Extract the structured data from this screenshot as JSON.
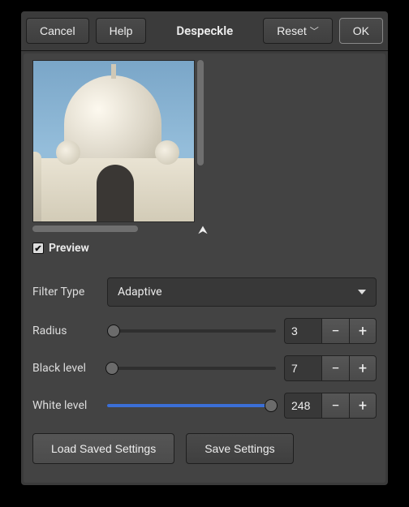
{
  "header": {
    "cancel": "Cancel",
    "help": "Help",
    "title": "Despeckle",
    "reset": "Reset",
    "ok": "OK"
  },
  "preview": {
    "checkbox_label": "Preview",
    "checked": true
  },
  "filter_type": {
    "label": "Filter Type",
    "value": "Adaptive"
  },
  "radius": {
    "label": "Radius",
    "value": "3",
    "min": 1,
    "max": 100,
    "percent": 4
  },
  "black_level": {
    "label": "Black level",
    "value": "7",
    "min": 0,
    "max": 255,
    "percent": 3
  },
  "white_level": {
    "label": "White level",
    "value": "248",
    "min": 0,
    "max": 255,
    "percent": 97
  },
  "footer": {
    "load": "Load Saved Settings",
    "save": "Save Settings"
  }
}
